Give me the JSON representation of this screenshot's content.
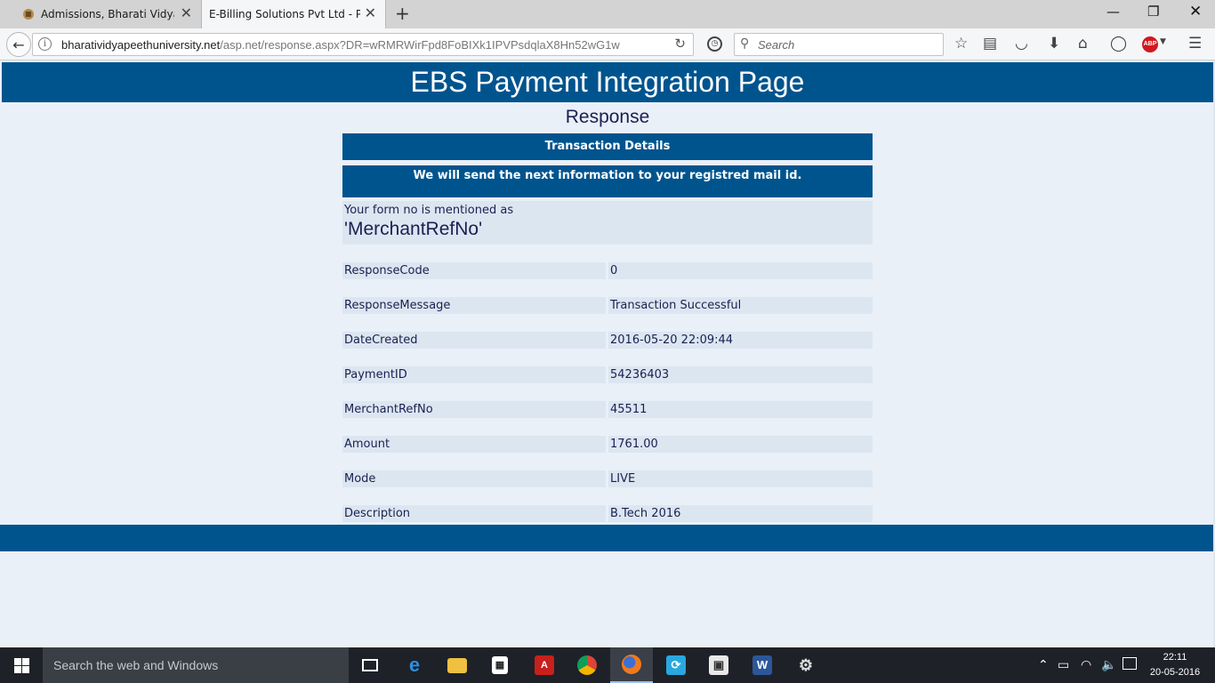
{
  "browser": {
    "tabs": [
      {
        "label": "Admissions, Bharati Vidya..."
      },
      {
        "label": "E-Billing Solutions Pvt Ltd - Pa..."
      }
    ],
    "url_host": "bharatividyapeethuniversity.net",
    "url_rest": "/asp.net/response.aspx?DR=wRMRWirFpd8FoBIXk1IPVPsdqlaX8Hn52wG1w",
    "search_placeholder": "Search"
  },
  "page": {
    "banner_title": "EBS Payment Integration Page",
    "subtitle": "Response",
    "section_header": "Transaction Details",
    "info_message": "We will send the next information to your registred mail id.",
    "form_note": "Your form no is mentioned as",
    "form_note_field": "'MerchantRefNo'",
    "details": [
      {
        "label": "ResponseCode",
        "value": "0"
      },
      {
        "label": "ResponseMessage",
        "value": "Transaction Successful"
      },
      {
        "label": "DateCreated",
        "value": "2016-05-20 22:09:44"
      },
      {
        "label": "PaymentID",
        "value": "54236403"
      },
      {
        "label": "MerchantRefNo",
        "value": "45511"
      },
      {
        "label": "Amount",
        "value": "1761.00"
      },
      {
        "label": "Mode",
        "value": "LIVE"
      },
      {
        "label": "Description",
        "value": "B.Tech 2016"
      }
    ]
  },
  "taskbar": {
    "search_placeholder": "Search the web and Windows",
    "time": "22:11",
    "date": "20-05-2016"
  },
  "colors": {
    "banner": "#00548e",
    "page_bg": "#eaf0f8",
    "cell_bg": "#dce6f1",
    "text": "#1a2050"
  }
}
